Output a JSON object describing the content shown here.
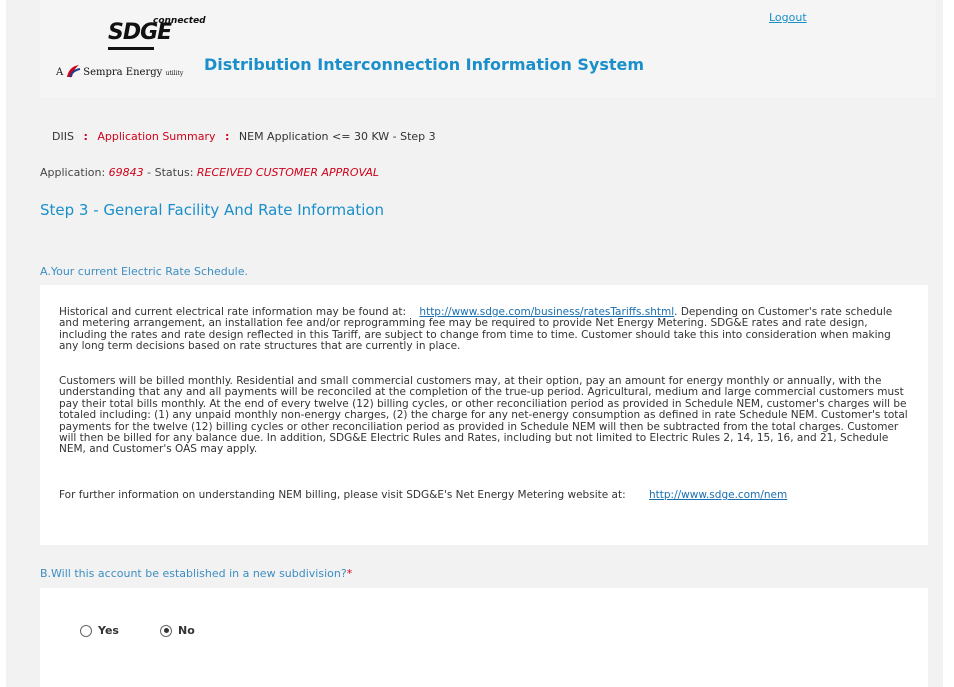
{
  "header": {
    "logo": {
      "brand": "SDGE",
      "tagline": "connected",
      "parent_prefix": "A",
      "parent_name": "Sempra Energy",
      "parent_suffix": "utility"
    },
    "title": "Distribution Interconnection Information System",
    "logout_label": "Logout"
  },
  "breadcrumb": {
    "root": "DIIS",
    "items": [
      "Application Summary"
    ],
    "current": "NEM Application <= 30 KW - Step 3"
  },
  "application": {
    "label": "Application:",
    "id": "69843",
    "status_label": "- Status:",
    "status": "RECEIVED CUSTOMER APPROVAL"
  },
  "step_title": "Step 3 - General Facility And Rate Information",
  "section_a": {
    "label": "A.Your current Electric Rate Schedule.",
    "p1_text_before": "Historical and current electrical rate information may be found at:",
    "p1_link": "http://www.sdge.com/business/ratesTariffs.shtml",
    "p1_text_after": ". Depending on Customer's rate schedule and metering arrangement, an installation fee and/or reprogramming fee may be required to provide Net Energy Metering. SDG&E rates and rate design, including the rates and rate design reflected in this Tariff, are subject to change from time to time. Customer should take this into consideration when making any long term decisions based on rate structures that are currently in place.",
    "p2": "Customers will be billed monthly. Residential and small commercial customers may, at their option, pay an amount for energy monthly or annually, with the understanding that any and all payments will be reconciled at the completion of the true-up period. Agricultural, medium and large commercial customers must pay their total bills monthly. At the end of every twelve (12) billing cycles, or other reconciliation period as provided in Schedule NEM, customer's charges will be totaled including: (1) any unpaid monthly non-energy charges, (2) the charge for any net-energy consumption as defined in rate Schedule NEM. Customer's total payments for the twelve (12) billing cycles or other reconciliation period as provided in Schedule NEM will then be subtracted from the total charges. Customer will then be billed for any balance due. In addition, SDG&E Electric Rules and Rates, including but not limited to Electric Rules 2, 14, 15, 16, and 21, Schedule NEM, and Customer's OAS may apply.",
    "p3_text": "For further information on understanding NEM billing, please visit SDG&E's Net Energy Metering website at:",
    "p3_link": "http://www.sdge.com/nem"
  },
  "section_b": {
    "label": "B.Will this account be established in a new subdivision?",
    "required_mark": "*",
    "options": [
      {
        "label": "Yes",
        "checked": false
      },
      {
        "label": "No",
        "checked": true
      }
    ]
  },
  "colors": {
    "accent_blue": "#1a8fc9",
    "link_blue": "#1a6fb0",
    "red": "#d0021b"
  }
}
